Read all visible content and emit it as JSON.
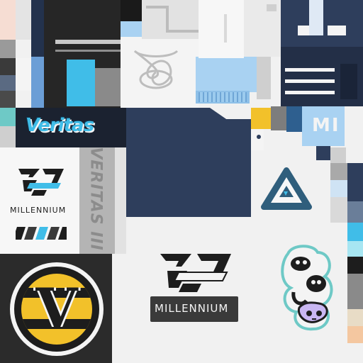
{
  "texture": {
    "colors": {
      "navy": "#2e3e5c",
      "sky": "#a9d2f2",
      "cyan": "#40bde8",
      "black": "#1d1d1d",
      "yellow": "#f2c12a",
      "mid_gray": "#8a8a8a",
      "lavender": "#c9b7f2",
      "teal": "#6ec9c6"
    },
    "decals": {
      "veritas_graffiti": {
        "text": "Veritas",
        "icon": "graffiti-wordmark"
      },
      "millennium_small": {
        "text": "MILLENNIUM",
        "icon": "millennium-emblem"
      },
      "veritas_vertical": {
        "text": "VERITAS III"
      },
      "veritas_badge": {
        "text": "V",
        "icon": "veritas-v-badge"
      },
      "millennium_large": {
        "text": "MILLENNIUM",
        "icon": "millennium-emblem"
      },
      "triangle_emblem": {
        "icon": "triangle-emblem"
      },
      "mini_tag": {
        "text": "MI"
      },
      "infinity_knot": {
        "icon": "infinity-knot-outline"
      },
      "sticker_cluster": {
        "icon": "cartoon-sticker-cluster"
      }
    }
  }
}
